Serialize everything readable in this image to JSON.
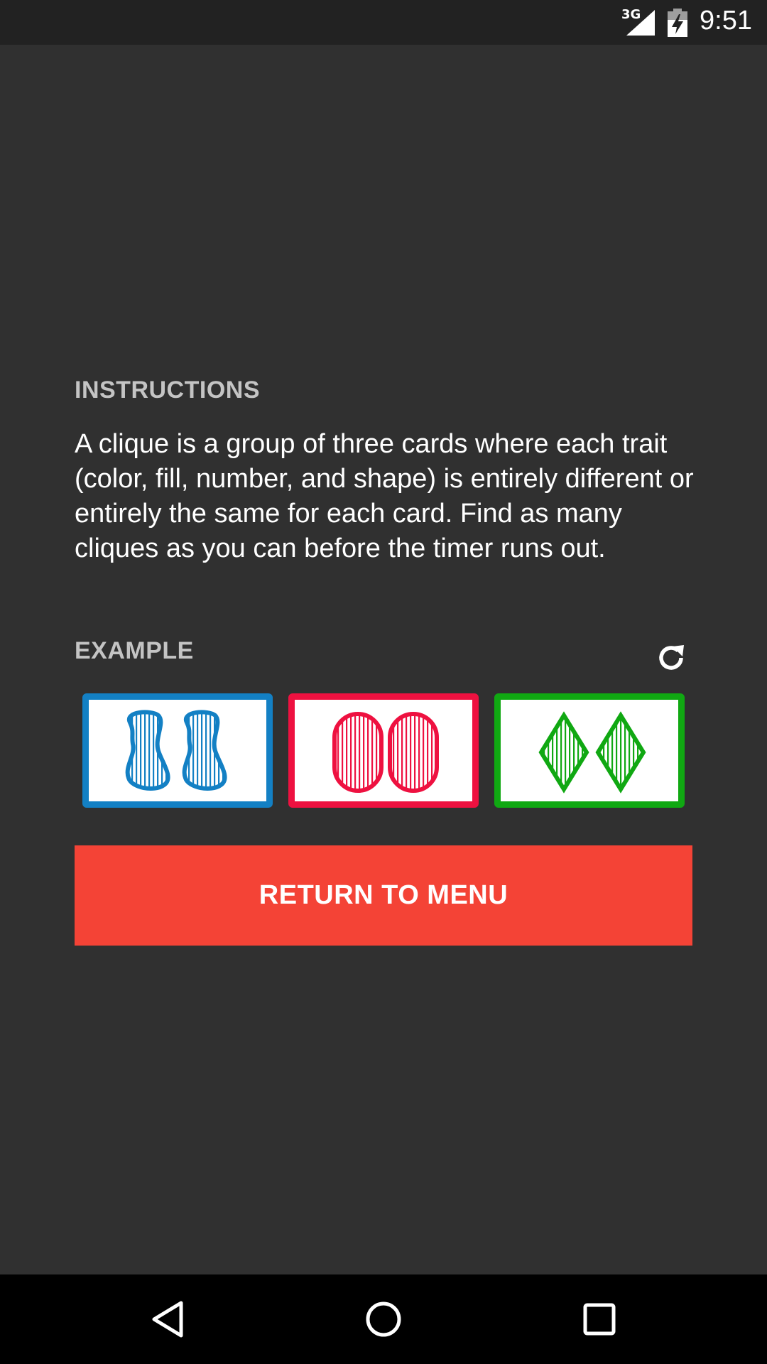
{
  "status_bar": {
    "network": "3G",
    "time": "9:51",
    "icons": [
      "signal-icon",
      "battery-charging-icon"
    ]
  },
  "instructions": {
    "heading": "INSTRUCTIONS",
    "body": "A clique is a group of three cards where each trait (color, fill, number, and shape) is entirely different or entirely the same for each card. Find as many cliques as you can before the timer runs out."
  },
  "example": {
    "heading": "EXAMPLE",
    "refresh_icon": "refresh-icon",
    "cards": [
      {
        "shape": "squiggle",
        "count": 2,
        "fill": "striped",
        "color": "#1380c4"
      },
      {
        "shape": "oval",
        "count": 2,
        "fill": "striped",
        "color": "#ee1140"
      },
      {
        "shape": "diamond",
        "count": 2,
        "fill": "striped",
        "color": "#10a812"
      }
    ]
  },
  "return_button": {
    "label": "RETURN TO MENU",
    "color": "#f44336"
  },
  "nav_bar": {
    "icons": [
      "back-icon",
      "home-icon",
      "recents-icon"
    ]
  }
}
